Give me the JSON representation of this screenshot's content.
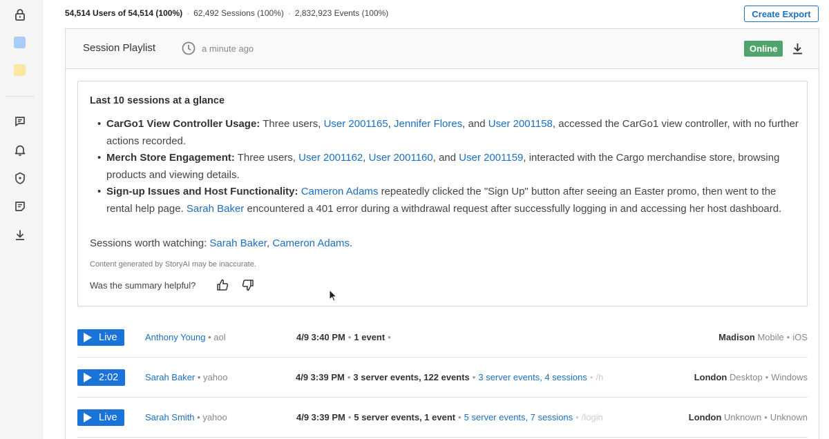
{
  "stats": {
    "users": "54,514 Users of 54,514 (100%)",
    "sessions": "62,492 Sessions (100%)",
    "events": "2,832,923 Events (100%)"
  },
  "export_label": "Create Export",
  "panel": {
    "title": "Session Playlist",
    "updated": "a minute ago",
    "status": "Online"
  },
  "summary": {
    "title": "Last 10 sessions at a glance",
    "b1": {
      "heading": "CarGo1 View Controller Usage:",
      "t1": " Three users, ",
      "u1": "User 2001165",
      "t2": ", ",
      "u2": "Jennifer Flores",
      "t3": ", and ",
      "u3": "User 2001158",
      "t4": ", accessed the CarGo1 view controller, with no further actions recorded."
    },
    "b2": {
      "heading": "Merch Store Engagement:",
      "t1": " Three users, ",
      "u1": "User 2001162",
      "t2": ", ",
      "u2": "User 2001160",
      "t3": ", and ",
      "u3": "User 2001159",
      "t4": ", interacted with the Cargo merchandise store, browsing products and viewing details."
    },
    "b3": {
      "heading": "Sign-up Issues and Host Functionality:",
      "t0": " ",
      "u1": "Cameron Adams",
      "t1": " repeatedly clicked the \"Sign Up\" button after seeing an Easter promo, then went to the rental help page. ",
      "u2": "Sarah Baker",
      "t2": " encountered a 401 error during a withdrawal request after successfully logging in and accessing her host dashboard."
    },
    "worth": {
      "label": "Sessions worth watching: ",
      "u1": "Sarah Baker",
      "sep": ", ",
      "u2": "Cameron Adams",
      "end": "."
    },
    "disclaimer": "Content generated by StoryAI may be inaccurate.",
    "helpful": "Was the summary helpful?"
  },
  "sessions": [
    {
      "play": "Live",
      "user": "Anthony Young",
      "provider": "aol",
      "time": "4/9 3:40 PM",
      "events": "1 event",
      "trail": "",
      "links": "",
      "page": "",
      "city": "Madison",
      "device": "Mobile",
      "os": "iOS"
    },
    {
      "play": "2:02",
      "user": "Sarah Baker",
      "provider": "yahoo",
      "time": "4/9 3:39 PM",
      "events": "3 server events, 122 events",
      "trail": "",
      "links": "3 server events, 4 sessions",
      "page": "/h",
      "city": "London",
      "device": "Desktop",
      "os": "Windows"
    },
    {
      "play": "Live",
      "user": "Sarah Smith",
      "provider": "yahoo",
      "time": "4/9 3:39 PM",
      "events": "5 server events, 1 event",
      "trail": "",
      "links": "5 server events, 7 sessions",
      "page": "/login",
      "city": "London",
      "device": "Unknown",
      "os": "Unknown"
    }
  ],
  "colors": {
    "accent": "#1a73d9",
    "online": "#4fa36c"
  },
  "icons": [
    "lock-icon",
    "chat-icon",
    "bell-icon",
    "shield-icon",
    "notes-icon",
    "download-icon",
    "clock-icon",
    "thumbs-up-icon",
    "thumbs-down-icon",
    "play-icon"
  ]
}
